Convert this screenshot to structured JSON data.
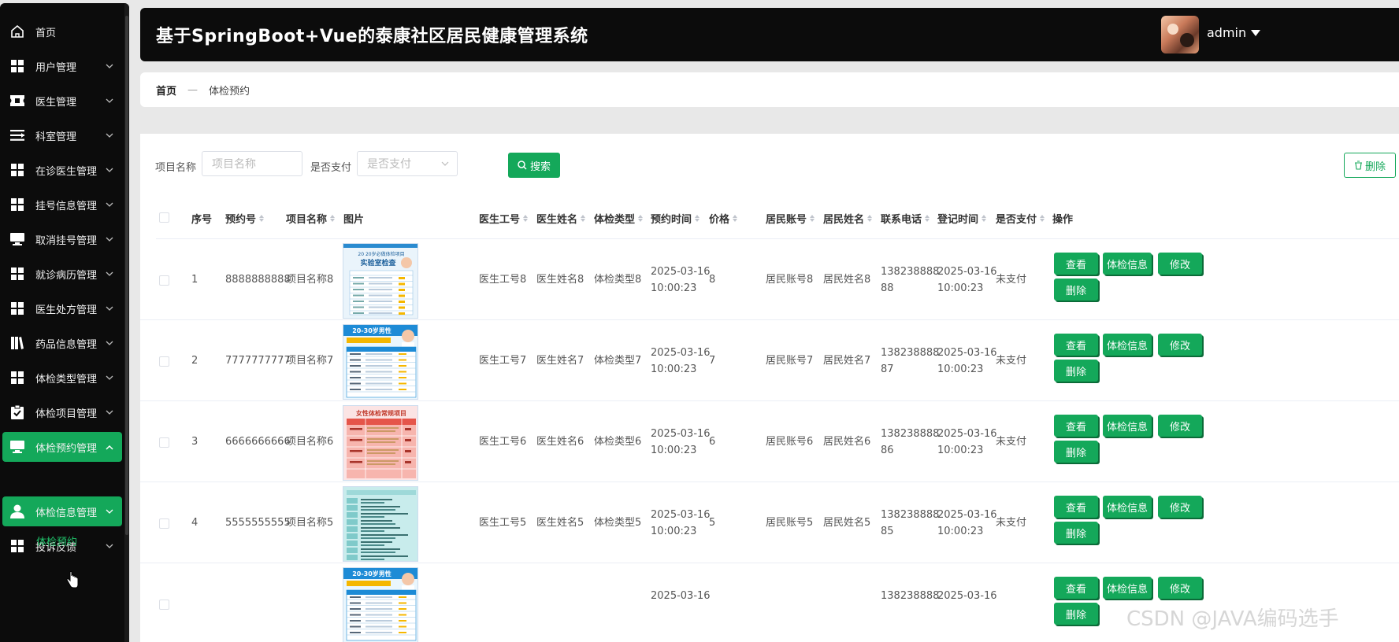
{
  "sidebar": {
    "items": [
      {
        "label": "首页",
        "icon": "home-icon",
        "arrow": false,
        "active": false
      },
      {
        "label": "用户管理",
        "icon": "grid-icon",
        "arrow": true,
        "active": false
      },
      {
        "label": "医生管理",
        "icon": "ticket-icon",
        "arrow": true,
        "active": false
      },
      {
        "label": "科室管理",
        "icon": "list-icon",
        "arrow": true,
        "active": false
      },
      {
        "label": "在诊医生管理",
        "icon": "grid-icon",
        "arrow": true,
        "active": false
      },
      {
        "label": "挂号信息管理",
        "icon": "grid-icon",
        "arrow": true,
        "active": false
      },
      {
        "label": "取消挂号管理",
        "icon": "monitor-icon",
        "arrow": true,
        "active": false
      },
      {
        "label": "就诊病历管理",
        "icon": "grid-icon",
        "arrow": true,
        "active": false
      },
      {
        "label": "医生处方管理",
        "icon": "grid-icon",
        "arrow": true,
        "active": false
      },
      {
        "label": "药品信息管理",
        "icon": "book-icon",
        "arrow": true,
        "active": false
      },
      {
        "label": "体检类型管理",
        "icon": "grid-icon",
        "arrow": true,
        "active": false
      },
      {
        "label": "体检项目管理",
        "icon": "clipboard-icon",
        "arrow": true,
        "active": false
      },
      {
        "label": "体检预约管理",
        "icon": "monitor-icon",
        "arrow": true,
        "active": true,
        "open": true
      },
      {
        "label": "体检信息管理",
        "icon": "user-icon",
        "arrow": true,
        "active": true
      },
      {
        "label": "投诉反馈",
        "icon": "grid-icon",
        "arrow": true,
        "active": false
      }
    ],
    "submenu_label": "体检预约"
  },
  "header": {
    "title": "基于SpringBoot+Vue的泰康社区居民健康管理系统",
    "user": "admin"
  },
  "breadcrumb": {
    "home": "首页",
    "separator": "—",
    "current": "体检预约"
  },
  "filters": {
    "project_label": "项目名称",
    "project_placeholder": "项目名称",
    "paid_label": "是否支付",
    "paid_placeholder": "是否支付",
    "search_label": "搜索",
    "delete_label": "删除"
  },
  "table": {
    "columns": [
      "序号",
      "预约号",
      "项目名称",
      "图片",
      "医生工号",
      "医生姓名",
      "体检类型",
      "预约时间",
      "价格",
      "居民账号",
      "居民姓名",
      "联系电话",
      "登记时间",
      "是否支付",
      "操作"
    ],
    "rows": [
      {
        "index": "1",
        "booking_no": "8888888888",
        "project": "项目名称8",
        "image": "poster-blue",
        "doc_id": "医生工号8",
        "doc_name": "医生姓名8",
        "type": "体检类型8",
        "time1": "2025-03-16",
        "time2": "10:00:23",
        "price": "8",
        "res_acc": "居民账号8",
        "res_name": "居民姓名8",
        "phone1": "138238888",
        "phone2": "88",
        "reg1": "2025-03-16",
        "reg2": "10:00:23",
        "paid": "未支付"
      },
      {
        "index": "2",
        "booking_no": "7777777777",
        "project": "项目名称7",
        "image": "poster-doctor",
        "doc_id": "医生工号7",
        "doc_name": "医生姓名7",
        "type": "体检类型7",
        "time1": "2025-03-16",
        "time2": "10:00:23",
        "price": "7",
        "res_acc": "居民账号7",
        "res_name": "居民姓名7",
        "phone1": "138238888",
        "phone2": "87",
        "reg1": "2025-03-16",
        "reg2": "10:00:23",
        "paid": "未支付"
      },
      {
        "index": "3",
        "booking_no": "6666666666",
        "project": "项目名称6",
        "image": "poster-pink",
        "doc_id": "医生工号6",
        "doc_name": "医生姓名6",
        "type": "体检类型6",
        "time1": "2025-03-16",
        "time2": "10:00:23",
        "price": "6",
        "res_acc": "居民账号6",
        "res_name": "居民姓名6",
        "phone1": "138238888",
        "phone2": "86",
        "reg1": "2025-03-16",
        "reg2": "10:00:23",
        "paid": "未支付"
      },
      {
        "index": "4",
        "booking_no": "5555555555",
        "project": "项目名称5",
        "image": "poster-teal",
        "doc_id": "医生工号5",
        "doc_name": "医生姓名5",
        "type": "体检类型5",
        "time1": "2025-03-16",
        "time2": "10:00:23",
        "price": "5",
        "res_acc": "居民账号5",
        "res_name": "居民姓名5",
        "phone1": "138238888",
        "phone2": "85",
        "reg1": "2025-03-16",
        "reg2": "10:00:23",
        "paid": "未支付"
      },
      {
        "index": "",
        "booking_no": "",
        "project": "",
        "image": "poster-doctor",
        "doc_id": "",
        "doc_name": "",
        "type": "",
        "time1": "2025-03-16",
        "time2": "",
        "price": "",
        "res_acc": "",
        "res_name": "",
        "phone1": "138238888",
        "phone2": "",
        "reg1": "2025-03-16",
        "reg2": "",
        "paid": ""
      }
    ],
    "ops": {
      "view": "查看",
      "info": "体检信息",
      "edit": "修改",
      "delete": "删除"
    }
  },
  "poster_texts": {
    "blue_title": "20 20岁必做体检项目",
    "blue_sub": "实验室检查",
    "doctor_title": "20-30岁男性",
    "pink_title": "女性体检常规项目"
  },
  "watermark": "CSDN @JAVA编码选手",
  "colors": {
    "accent": "#14a85a",
    "header_bg": "#0c0c0c"
  }
}
